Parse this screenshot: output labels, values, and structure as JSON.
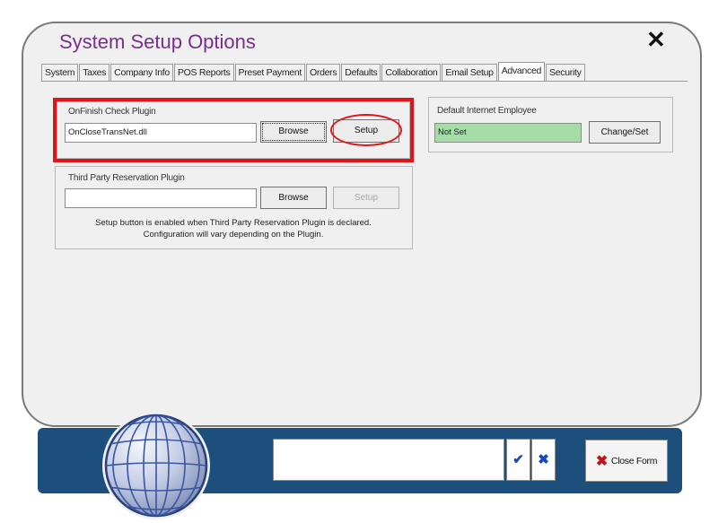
{
  "window": {
    "title": "System Setup Options",
    "close_glyph": "✕"
  },
  "tabs": [
    {
      "label": "System"
    },
    {
      "label": "Taxes"
    },
    {
      "label": "Company Info"
    },
    {
      "label": "POS Reports"
    },
    {
      "label": "Preset Payment"
    },
    {
      "label": "Orders"
    },
    {
      "label": "Defaults"
    },
    {
      "label": "Collaboration"
    },
    {
      "label": "Email Setup"
    },
    {
      "label": "Advanced",
      "active": true
    },
    {
      "label": "Security"
    }
  ],
  "onfinish": {
    "label": "OnFinish Check Plugin",
    "value": "OnCloseTransNet.dll",
    "browse": "Browse",
    "setup": "Setup"
  },
  "thirdparty": {
    "label": "Third Party Reservation Plugin",
    "value": "",
    "browse": "Browse",
    "setup": "Setup",
    "note_line1": "Setup button is enabled when Third Party Reservation Plugin is declared.",
    "note_line2": "Configuration will vary depending on the Plugin."
  },
  "internet_employee": {
    "label": "Default Internet Employee",
    "value": "Not Set",
    "change": "Change/Set"
  },
  "bottom": {
    "confirm_glyph": "✔",
    "cancel_glyph": "✖",
    "close_icon": "✖",
    "close_label": "Close Form"
  },
  "colors": {
    "title": "#7b2d8e",
    "highlight": "#e0151b",
    "bar": "#1d4f7c",
    "employee_field": "#a6dca8"
  },
  "icons": [
    "close-icon",
    "globe-logo-icon",
    "check-icon",
    "x-icon",
    "close-form-icon"
  ]
}
